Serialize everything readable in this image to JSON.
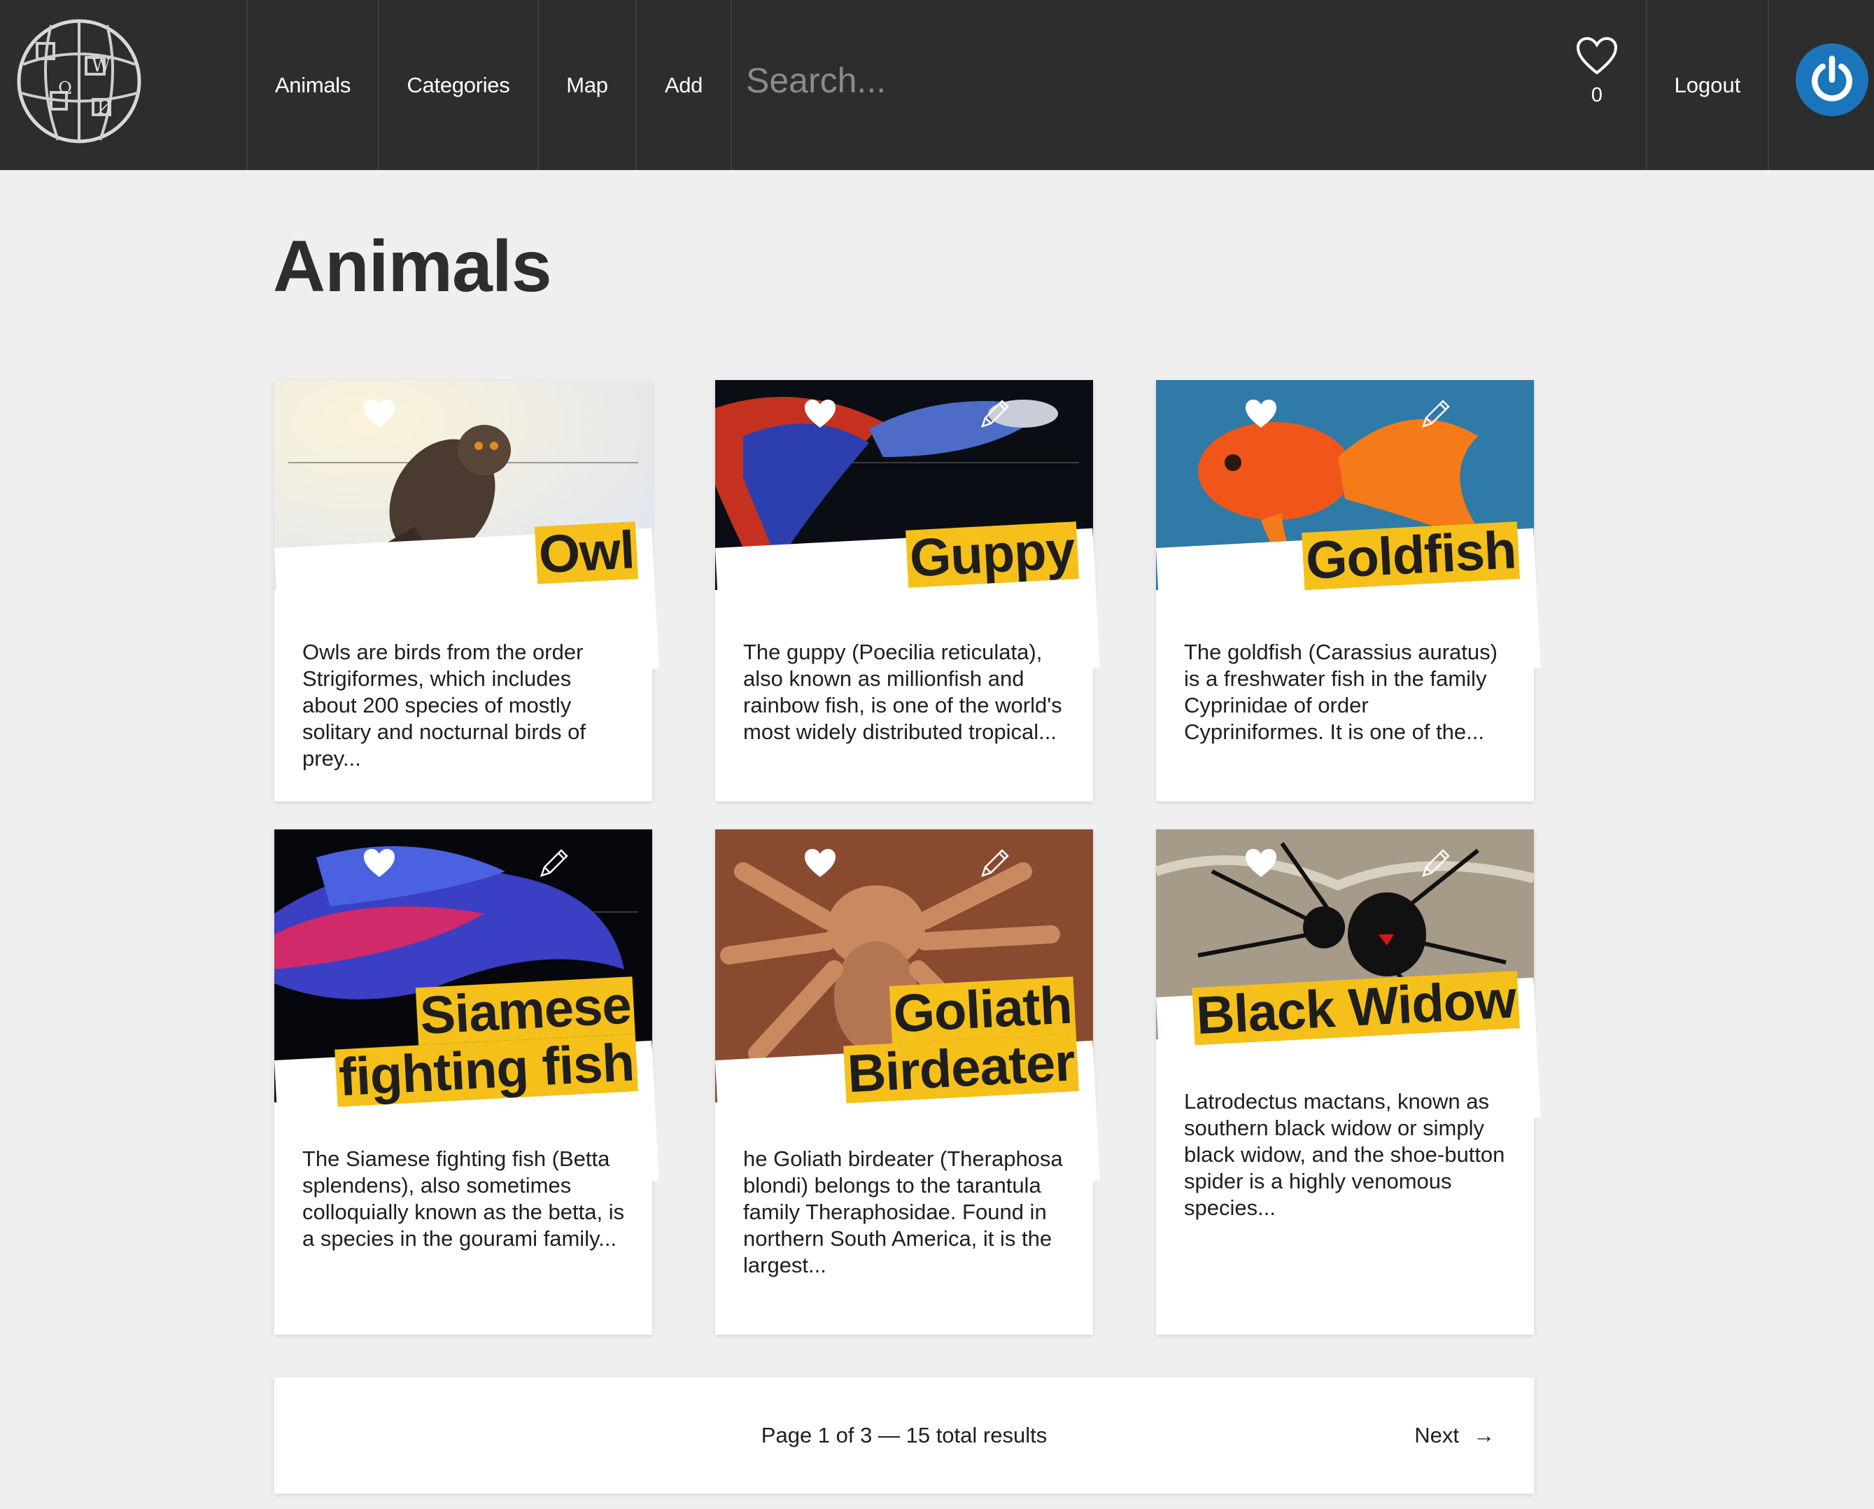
{
  "nav": {
    "links": [
      "Animals",
      "Categories",
      "Map",
      "Add"
    ],
    "search_placeholder": "Search...",
    "favorites_count": "0",
    "logout_label": "Logout"
  },
  "page_title": "Animals",
  "cards": [
    {
      "title_lines": [
        "Owl"
      ],
      "description": "Owls are birds from the order Strigiformes, which includes about 200 species of mostly solitary and nocturnal birds of prey..."
    },
    {
      "title_lines": [
        "Guppy"
      ],
      "description": "The guppy (Poecilia reticulata), also known as millionfish and rainbow fish, is one of the world's most widely distributed tropical..."
    },
    {
      "title_lines": [
        "Goldfish"
      ],
      "description": "The goldfish (Carassius auratus) is a freshwater fish in the family Cyprinidae of order Cypriniformes. It is one of the..."
    },
    {
      "title_lines": [
        "Siamese",
        "fighting fish"
      ],
      "description": "The Siamese fighting fish (Betta splendens), also sometimes colloquially known as the betta, is a species in the gourami family..."
    },
    {
      "title_lines": [
        "Goliath",
        "Birdeater"
      ],
      "description": "he Goliath birdeater (Theraphosa blondi) belongs to the tarantula family Theraphosidae. Found in northern South America, it is the largest..."
    },
    {
      "title_lines": [
        "Black Widow"
      ],
      "description": "Latrodectus mactans, known as southern black widow or simply black widow, and the shoe-button spider is a highly venomous species..."
    }
  ],
  "pagination": {
    "status": "Page 1 of 3 — 15 total results",
    "next_label": "Next",
    "next_arrow": "→"
  }
}
